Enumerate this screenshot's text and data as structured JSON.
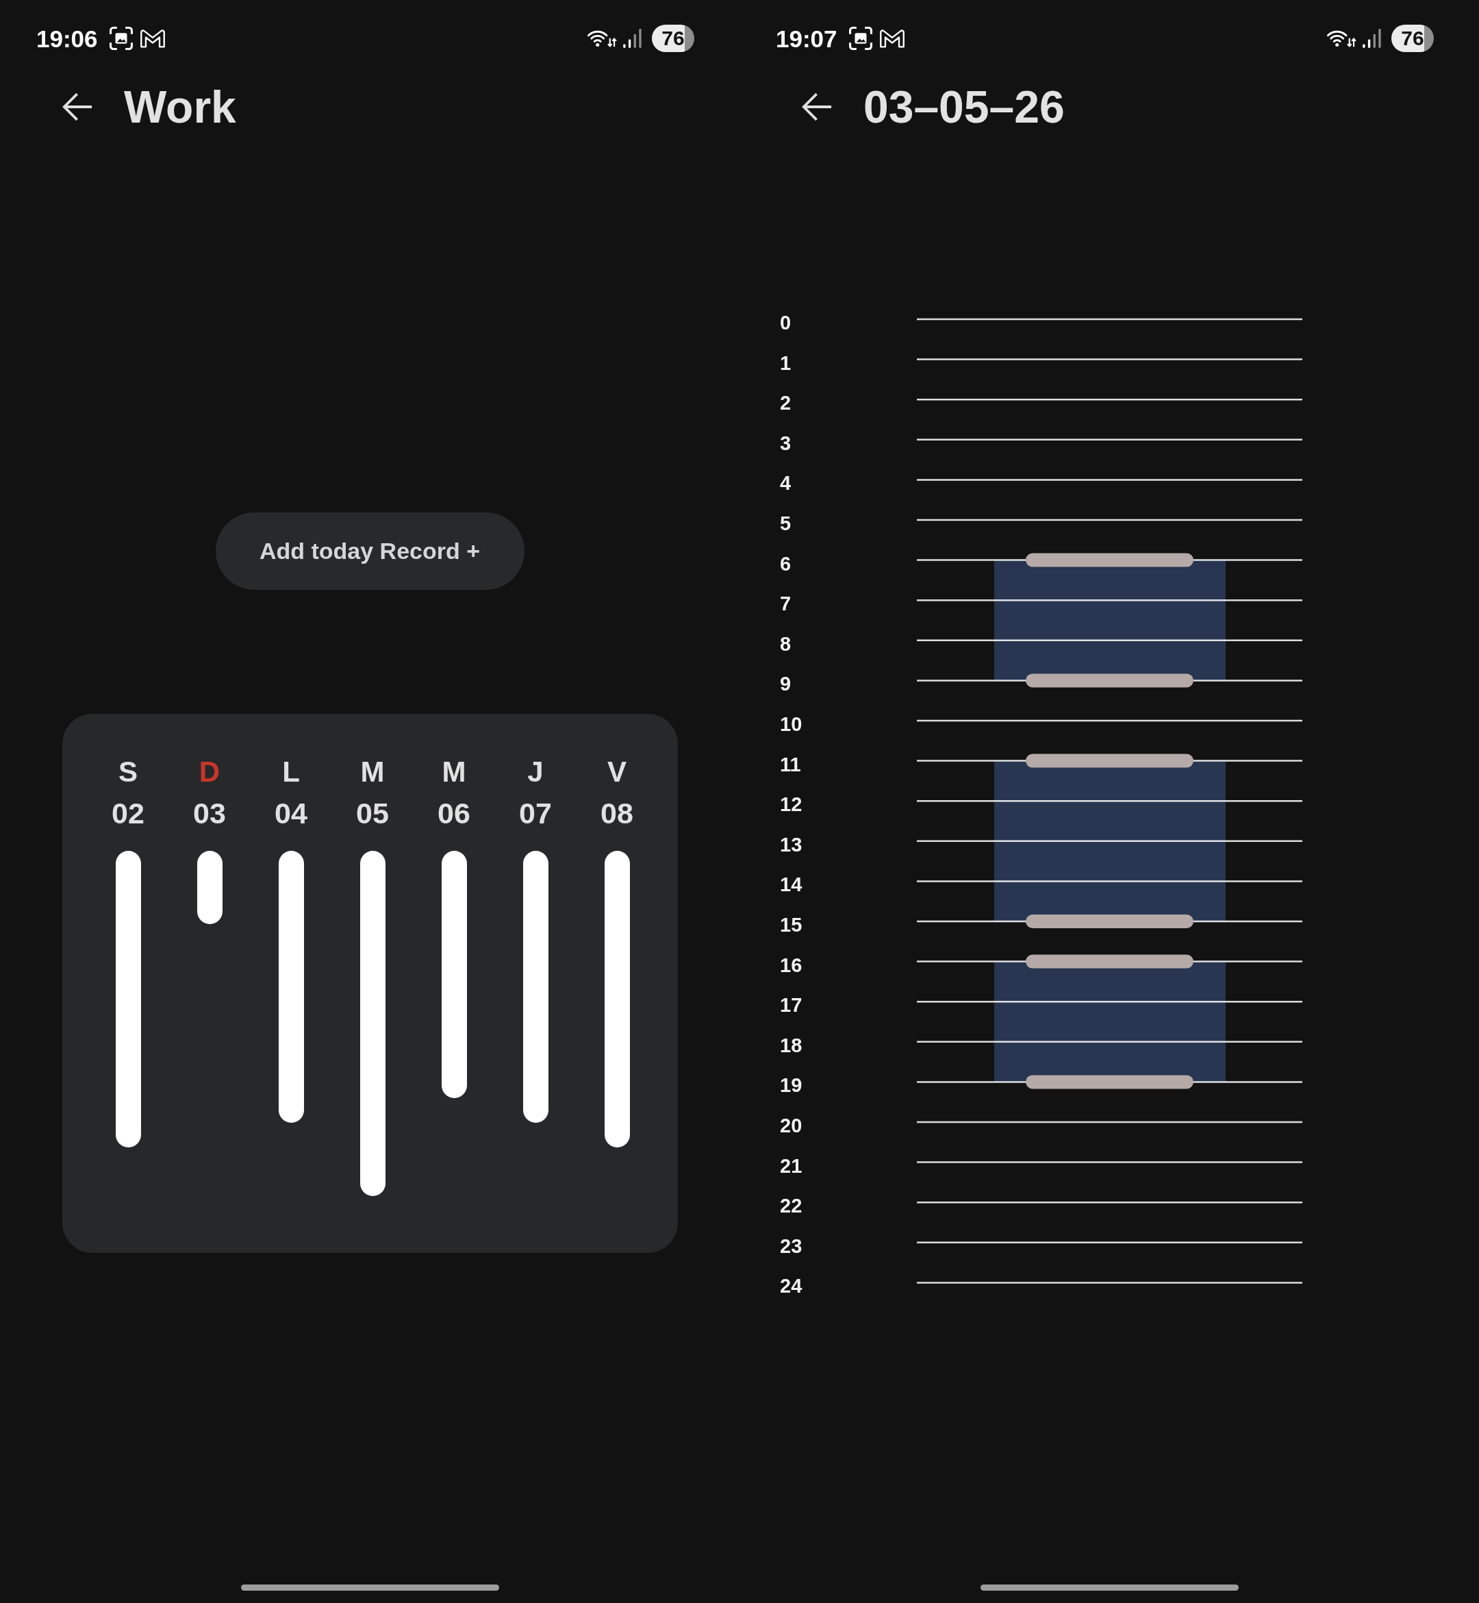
{
  "week_screen": {
    "status_bar": {
      "time": "19:06",
      "battery": "76"
    },
    "header": {
      "title": "Work"
    },
    "add_button": {
      "label": "Add today Record +"
    },
    "week": {
      "days": [
        {
          "weekday": "S",
          "date": "02",
          "highlighted": false
        },
        {
          "weekday": "D",
          "date": "03",
          "highlighted": true
        },
        {
          "weekday": "L",
          "date": "04",
          "highlighted": false
        },
        {
          "weekday": "M",
          "date": "05",
          "highlighted": false
        },
        {
          "weekday": "M",
          "date": "06",
          "highlighted": false
        },
        {
          "weekday": "J",
          "date": "07",
          "highlighted": false
        },
        {
          "weekday": "V",
          "date": "08",
          "highlighted": false
        }
      ]
    }
  },
  "day_screen": {
    "status_bar": {
      "time": "19:07",
      "battery": "76"
    },
    "header": {
      "title": "03–05–26"
    },
    "timeline": {
      "hours": [
        {
          "label": "0",
          "recorded": false
        },
        {
          "label": "1",
          "recorded": false
        },
        {
          "label": "2",
          "recorded": false
        },
        {
          "label": "3",
          "recorded": false
        },
        {
          "label": "4",
          "recorded": false
        },
        {
          "label": "5",
          "recorded": false
        },
        {
          "label": "6",
          "recorded": true
        },
        {
          "label": "7",
          "recorded": true
        },
        {
          "label": "8",
          "recorded": true
        },
        {
          "label": "9",
          "recorded": false
        },
        {
          "label": "10",
          "recorded": false
        },
        {
          "label": "11",
          "recorded": true
        },
        {
          "label": "12",
          "recorded": true
        },
        {
          "label": "13",
          "recorded": true
        },
        {
          "label": "14",
          "recorded": true
        },
        {
          "label": "15",
          "recorded": false
        },
        {
          "label": "16",
          "recorded": true
        },
        {
          "label": "17",
          "recorded": true
        },
        {
          "label": "18",
          "recorded": true
        },
        {
          "label": "19",
          "recorded": false
        },
        {
          "label": "20",
          "recorded": false
        },
        {
          "label": "21",
          "recorded": false
        },
        {
          "label": "22",
          "recorded": false
        },
        {
          "label": "23",
          "recorded": false
        },
        {
          "label": "24",
          "recorded": false
        }
      ]
    }
  }
}
